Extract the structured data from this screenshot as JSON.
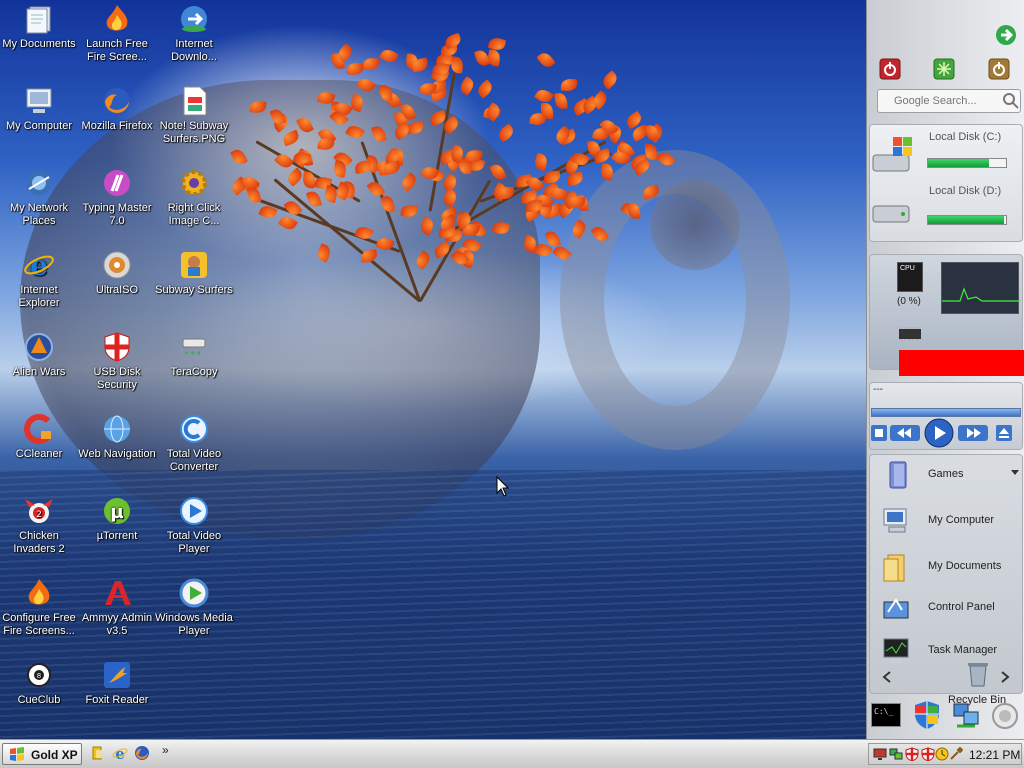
{
  "desktop_icons": [
    {
      "label": "My Documents",
      "icon": "my-documents-icon"
    },
    {
      "label": "My Computer",
      "icon": "my-computer-icon"
    },
    {
      "label": "My Network Places",
      "icon": "network-places-icon"
    },
    {
      "label": "Internet Explorer",
      "icon": "internet-explorer-icon"
    },
    {
      "label": "Alien Wars",
      "icon": "alien-wars-icon"
    },
    {
      "label": "CCleaner",
      "icon": "ccleaner-icon"
    },
    {
      "label": "Chicken Invaders 2",
      "icon": "chicken-invaders-icon"
    },
    {
      "label": "Configure Free Fire Screens...",
      "icon": "fire-screensaver-icon"
    },
    {
      "label": "CueClub",
      "icon": "cueclub-icon"
    },
    {
      "label": "Launch Free Fire Scree...",
      "icon": "fire-screensaver-icon"
    },
    {
      "label": "Mozilla Firefox",
      "icon": "firefox-icon"
    },
    {
      "label": "Typing Master 7.0",
      "icon": "typing-master-icon"
    },
    {
      "label": "UltraISO",
      "icon": "ultraiso-icon"
    },
    {
      "label": "USB Disk Security",
      "icon": "usb-security-shield-icon"
    },
    {
      "label": "Web Navigation",
      "icon": "web-globe-icon"
    },
    {
      "label": "µTorrent",
      "icon": "utorrent-icon"
    },
    {
      "label": "Ammyy Admin v3.5",
      "icon": "ammyy-admin-icon"
    },
    {
      "label": "Foxit Reader",
      "icon": "foxit-reader-icon"
    },
    {
      "label": "Internet Downlo...",
      "icon": "internet-download-manager-icon"
    },
    {
      "label": "Note! Subway Surfers.PNG",
      "icon": "png-file-icon"
    },
    {
      "label": "Right Click Image C...",
      "icon": "gear-icon"
    },
    {
      "label": "Subway Surfers",
      "icon": "subway-surfers-icon"
    },
    {
      "label": "TeraCopy",
      "icon": "teracopy-icon"
    },
    {
      "label": "Total Video Converter",
      "icon": "video-converter-icon"
    },
    {
      "label": "Total Video Player",
      "icon": "video-player-icon"
    },
    {
      "label": "Windows Media Player",
      "icon": "media-player-icon"
    }
  ],
  "sidebar": {
    "search_placeholder": "Google Search...",
    "disks": [
      {
        "label": "Local Disk (C:)",
        "used": 0.78
      },
      {
        "label": "Local Disk (D:)",
        "used": 0.98
      }
    ],
    "cpu": {
      "label": "CPU",
      "percent": "(0 %)"
    },
    "media_player": {
      "status": "---",
      "progress": 1.0
    },
    "launch_items": [
      {
        "label": "Games",
        "icon": "games-folder-icon"
      },
      {
        "label": "My Computer",
        "icon": "my-computer-icon"
      },
      {
        "label": "My Documents",
        "icon": "my-documents-folder-icon"
      },
      {
        "label": "Control Panel",
        "icon": "control-panel-icon"
      },
      {
        "label": "Task Manager",
        "icon": "task-manager-icon"
      },
      {
        "label": "Recycle Bin",
        "icon": "recycle-bin-icon"
      }
    ],
    "cmd_prompt_text": "C:\\_"
  },
  "taskbar": {
    "start_label": "Gold XP",
    "quicklaunch_more": "»",
    "clock": "12:21 PM"
  },
  "colors": {
    "accent_green": "#2bb24c",
    "red_block": "#ff0000",
    "taskbar_bg": "#d6d6d6"
  }
}
